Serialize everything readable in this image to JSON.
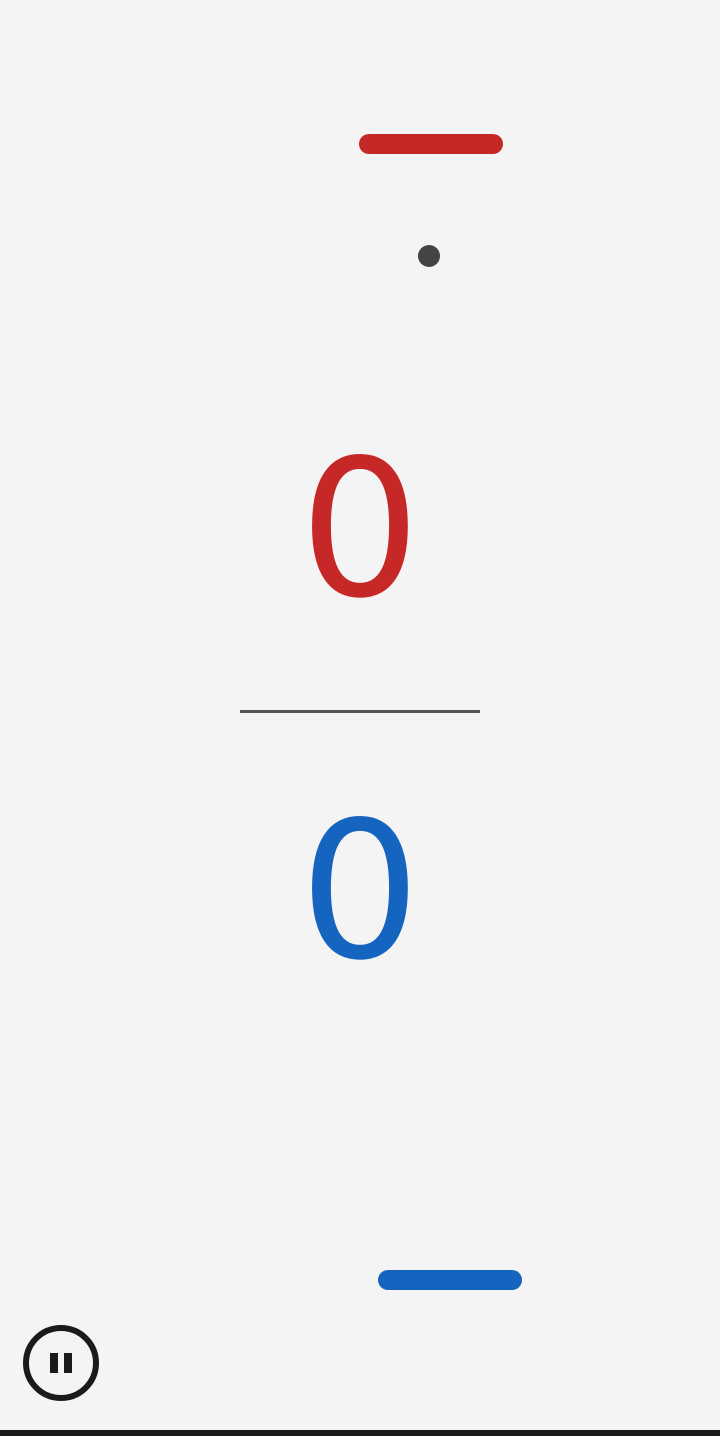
{
  "game": {
    "top_player": {
      "score": "0",
      "color": "#c62828"
    },
    "bottom_player": {
      "score": "0",
      "color": "#1565c0"
    },
    "ball": {
      "color": "#444444"
    },
    "pause_control": {
      "icon": "pause-circle-icon",
      "state": "playing"
    }
  }
}
